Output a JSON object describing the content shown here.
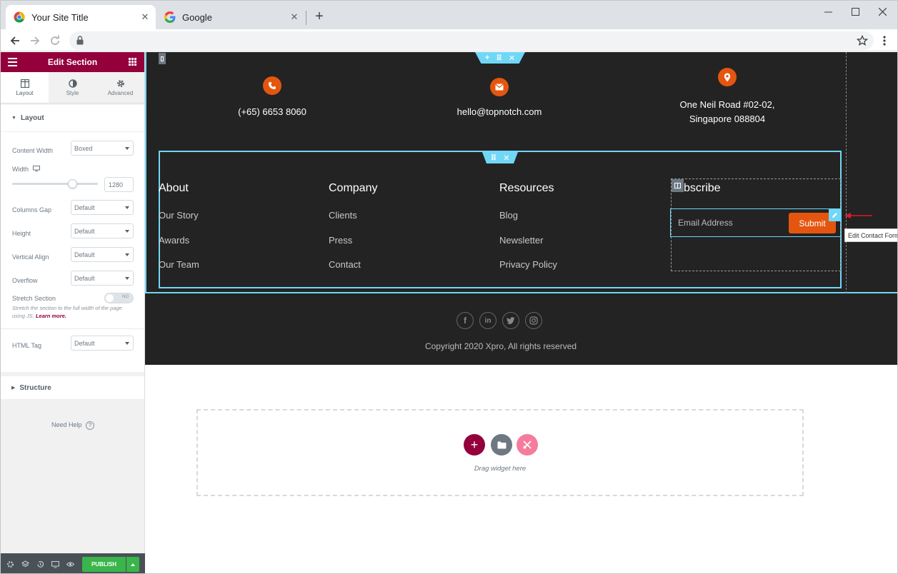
{
  "browser": {
    "tabs": [
      {
        "title": "Your Site Title"
      },
      {
        "title": "Google"
      }
    ]
  },
  "editor": {
    "header_title": "Edit Section",
    "tabs": [
      {
        "label": "Layout"
      },
      {
        "label": "Style"
      },
      {
        "label": "Advanced"
      }
    ],
    "layout_section": {
      "title": "Layout",
      "content_width": {
        "label": "Content Width",
        "value": "Boxed"
      },
      "width": {
        "label": "Width",
        "value": "1280"
      },
      "columns_gap": {
        "label": "Columns Gap",
        "value": "Default"
      },
      "height": {
        "label": "Height",
        "value": "Default"
      },
      "vertical_align": {
        "label": "Vertical Align",
        "value": "Default"
      },
      "overflow": {
        "label": "Overflow",
        "value": "Default"
      },
      "stretch": {
        "label": "Stretch Section",
        "toggle": "NO",
        "desc": "Stretch the section to the full width of the page using JS.",
        "link": "Learn more."
      },
      "html_tag": {
        "label": "HTML Tag",
        "value": "Default"
      }
    },
    "structure_title": "Structure",
    "need_help": "Need Help",
    "publish_label": "PUBLISH"
  },
  "site": {
    "contact": [
      {
        "icon": "phone-icon",
        "text": "(+65) 6653 8060"
      },
      {
        "icon": "mail-icon",
        "text": "hello@topnotch.com"
      },
      {
        "icon": "location-icon",
        "line1": "One Neil Road #02-02,",
        "line2": "Singapore 088804"
      }
    ],
    "columns": [
      {
        "heading": "About",
        "links": [
          "Our Story",
          "Awards",
          "Our Team"
        ]
      },
      {
        "heading": "Company",
        "links": [
          "Clients",
          "Press",
          "Contact"
        ]
      },
      {
        "heading": "Resources",
        "links": [
          "Blog",
          "Newsletter",
          "Privacy Policy"
        ]
      }
    ],
    "subscribe": {
      "heading": "bscribe",
      "placeholder": "Email Address",
      "button": "Submit"
    },
    "tooltip": "Edit Contact Form",
    "copyright": "Copyright 2020 Xpro, All rights reserved",
    "drop_zone_text": "Drag widget here"
  },
  "colors": {
    "accent": "#93003c",
    "orange": "#e4560f",
    "selection": "#71d7f7",
    "publish": "#39b54a"
  }
}
